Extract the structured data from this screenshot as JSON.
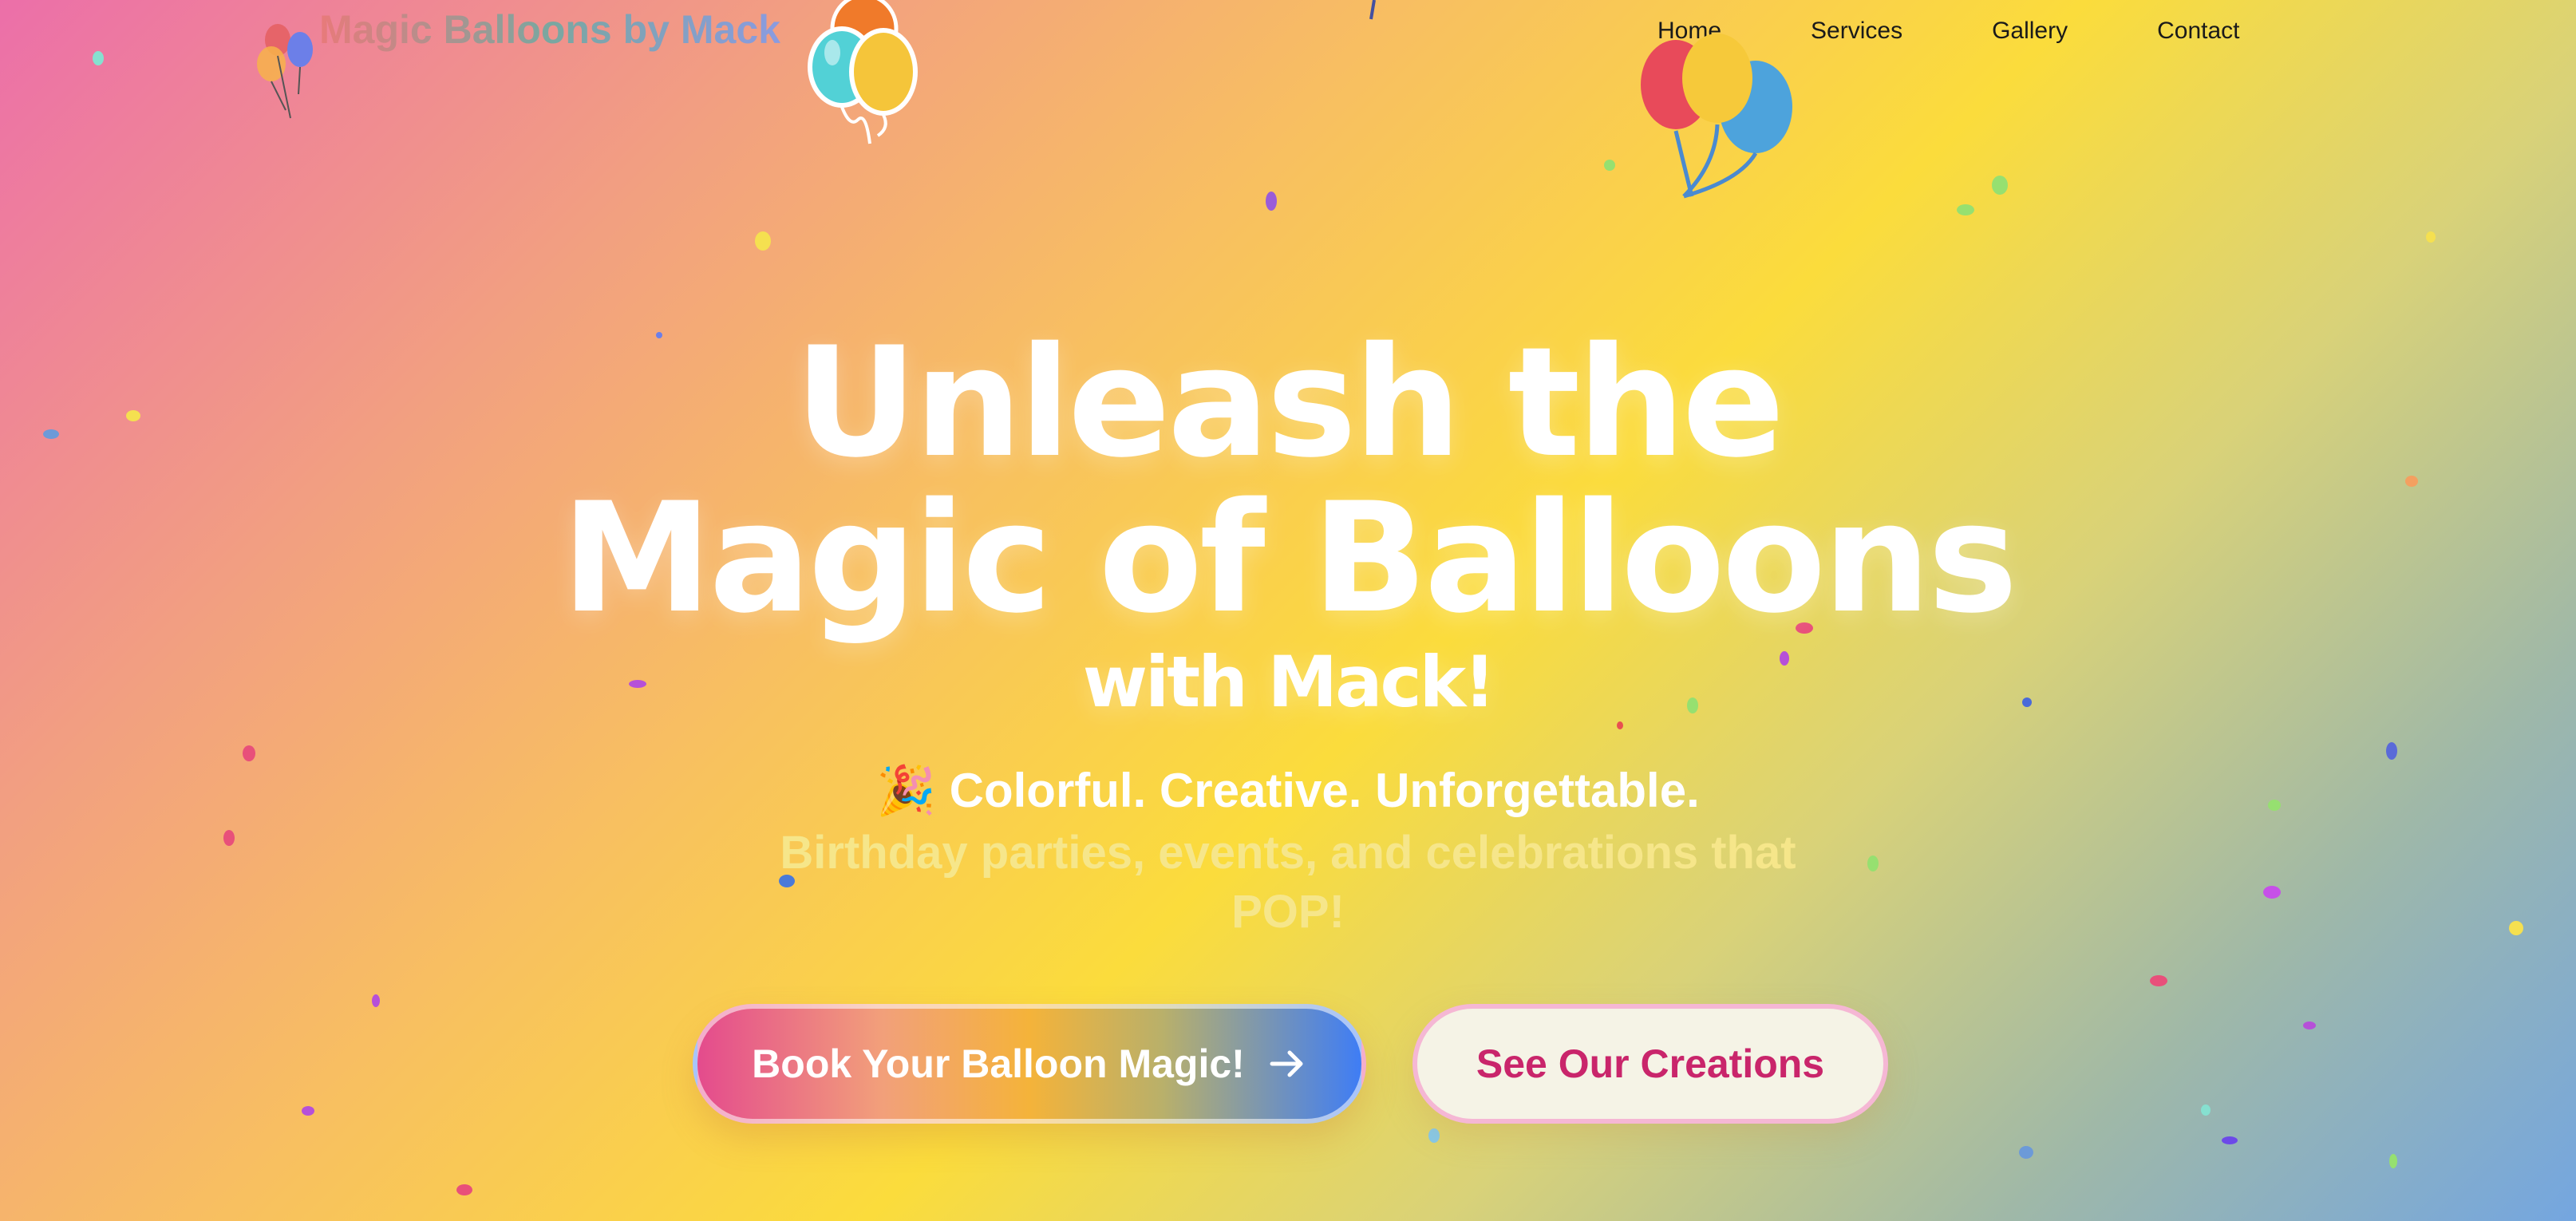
{
  "header": {
    "brand": "Magic Balloons by Mack",
    "nav": [
      "Home",
      "Services",
      "Gallery",
      "Contact"
    ]
  },
  "hero": {
    "title_line1": "Unleash the",
    "title_line2": "Magic of Balloons",
    "title_line3": "with Mack!",
    "tagline_icon": "party-popper-icon",
    "tagline": "Colorful. Creative. Unforgettable.",
    "subtitle": "Birthday parties, events, and celebrations that POP!"
  },
  "cta": {
    "primary_label": "Book Your Balloon Magic!",
    "primary_icon": "arrow-right-icon",
    "secondary_label": "See Our Creations"
  },
  "decor": {
    "icons": [
      "balloon-cluster-icon",
      "balloon-pair-icon",
      "balloon-trio-icon"
    ],
    "colors": {
      "pink": "#e44b8d",
      "yellow": "#fbdc3c",
      "blue": "#3f7df5",
      "accent_text": "#c9256b"
    }
  }
}
